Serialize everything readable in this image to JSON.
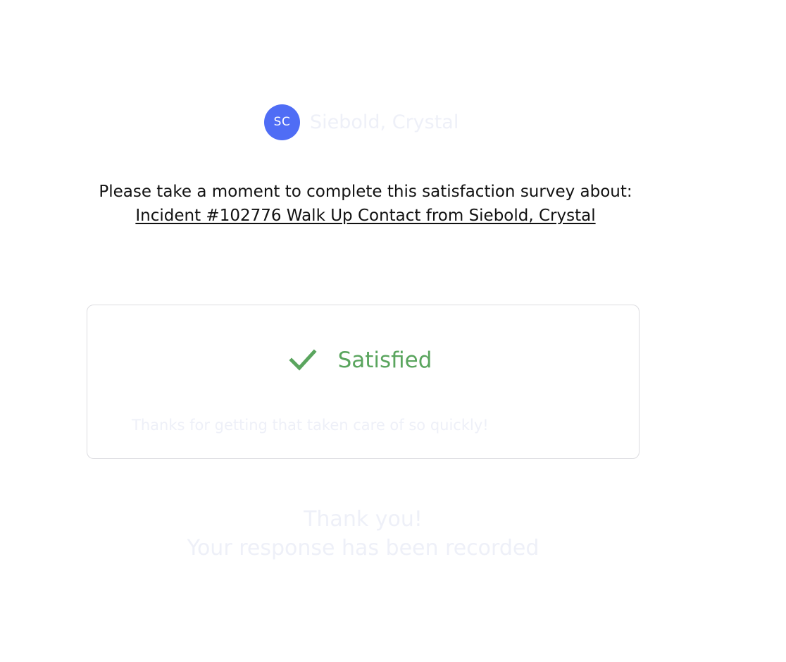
{
  "agent": {
    "initials": "SC",
    "name": "Siebold, Crystal",
    "avatar_color": "#4f6df5"
  },
  "survey": {
    "prompt": "Please take a moment to complete this satisfaction survey about:",
    "incident_link": "Incident #102776 Walk Up Contact from Siebold, Crystal"
  },
  "response": {
    "icon": "checkmark-icon",
    "rating": "Satisfied",
    "rating_color": "#5aa55e",
    "comment": "Thanks for getting that taken care of so quickly!"
  },
  "confirmation": {
    "line1": "Thank you!",
    "line2": "Your response has been recorded"
  }
}
